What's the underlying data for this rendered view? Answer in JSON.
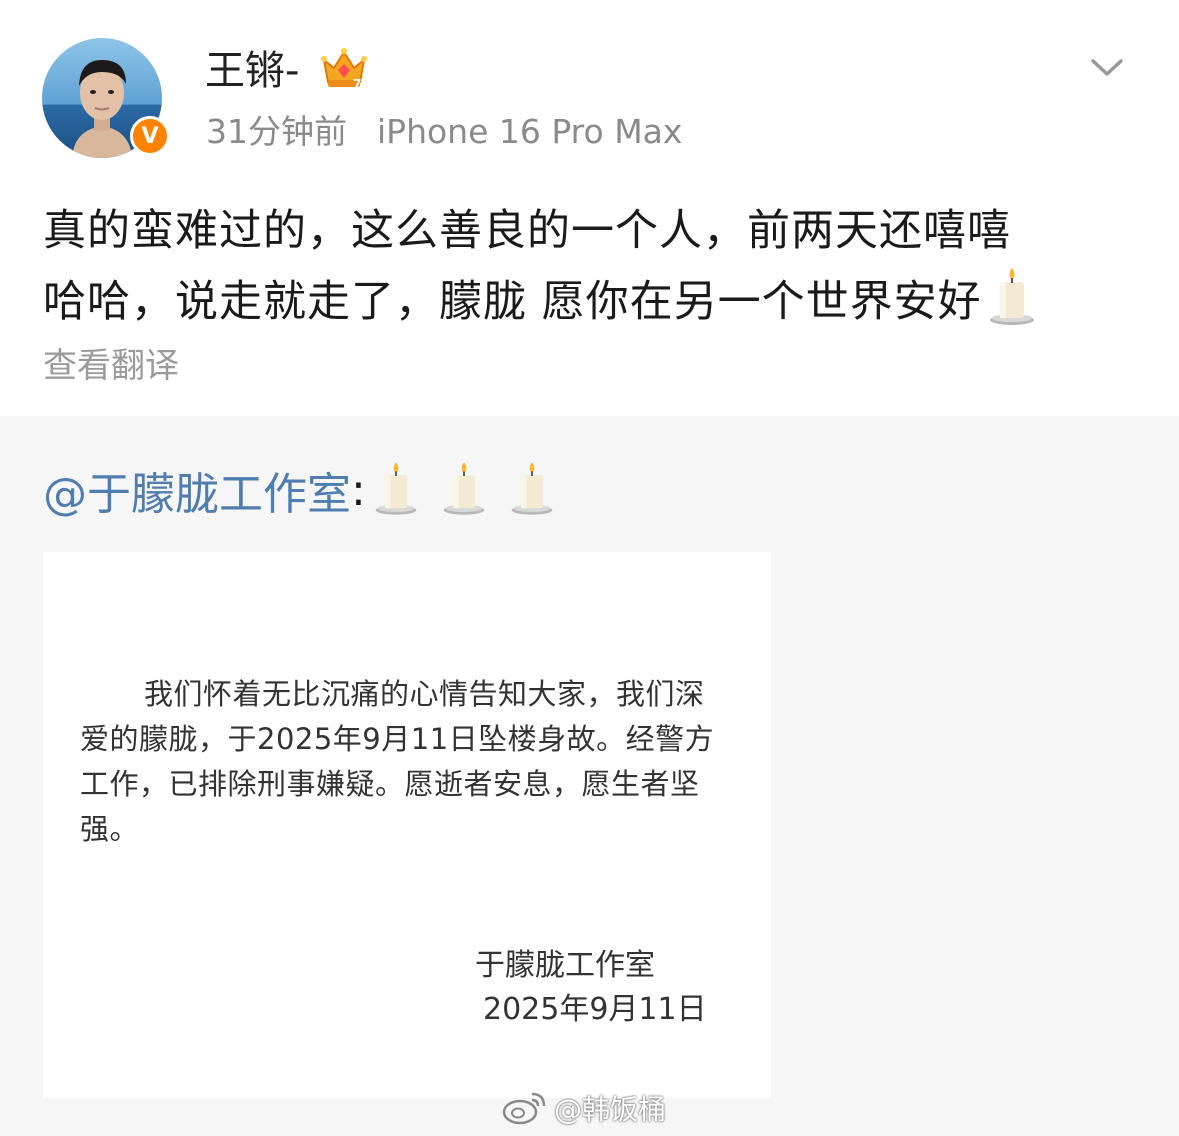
{
  "post": {
    "username": "王锵-",
    "crown_badge": "crown-icon",
    "verified_badge": "V",
    "timestamp": "31分钟前",
    "device": "iPhone 16 Pro Max",
    "text_line1": "真的蛮难过的，这么善良的一个人，前两天还嘻嘻",
    "text_line2": "哈哈，说走就走了，朦胧 愿你在另一个世界安好",
    "translate_label": "查看翻译"
  },
  "repost": {
    "mention": "@于朦胧工作室",
    "colon": ":",
    "emoji_count": 3,
    "notice": {
      "body": "我们怀着无比沉痛的心情告知大家，我们深爱的朦胧，于2025年9月11日坠楼身故。经警方工作，已排除刑事嫌疑。愿逝者安息，愿生者坚强。",
      "signature": "于朦胧工作室",
      "date": "2025年9月11日"
    }
  },
  "watermark": "@韩饭桶",
  "colors": {
    "link": "#507daf",
    "verified": "#ff8200",
    "meta": "#8a8a8a",
    "background": "#f6f6f6"
  }
}
